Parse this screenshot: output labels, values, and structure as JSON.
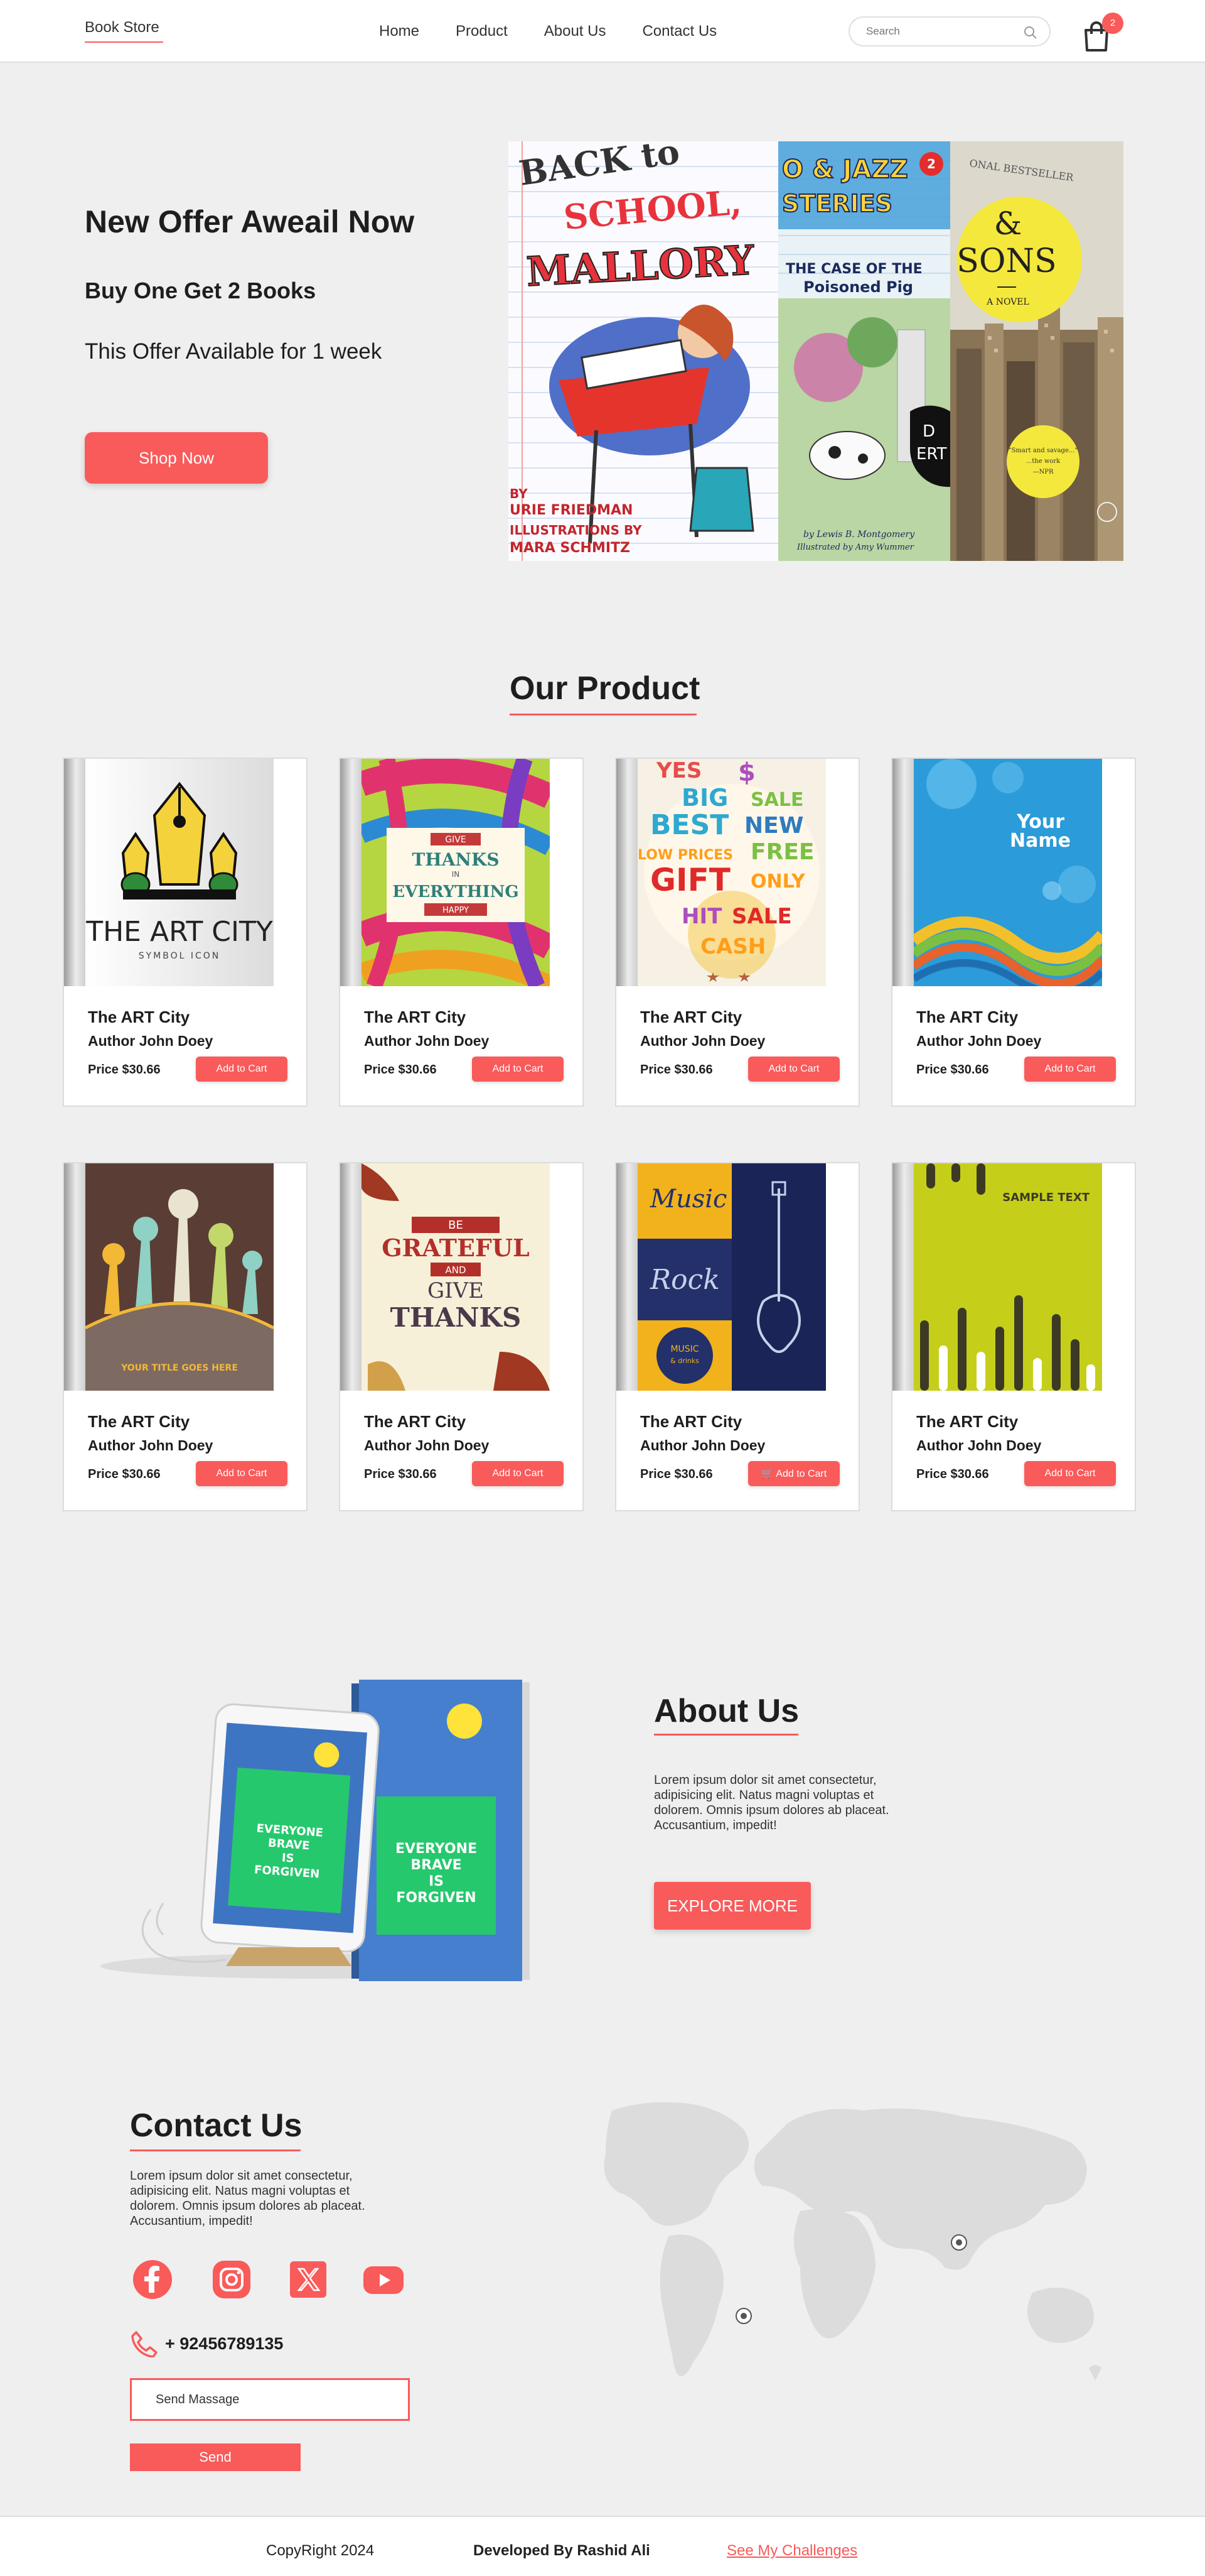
{
  "navbar": {
    "logo": "Book Store",
    "links": [
      "Home",
      "Product",
      "About Us",
      "Contact Us"
    ],
    "search_placeholder": "Search",
    "cart_count": "2"
  },
  "hero": {
    "title": "New Offer Aweail Now",
    "subtitle": "Buy One Get 2 Books",
    "offer": "This Offer Available for 1 week",
    "button": "Shop Now",
    "books": [
      {
        "title": "BACK TO SCHOOL, MALLORY",
        "author": "BY LAURIE FRIEDMAN",
        "illustrator": "ILLUSTRATIONS BY TAMARA SCHMITZ"
      },
      {
        "title": "ZEKE & JAZZ MYSTERIES",
        "badge": "2",
        "subtitle": "THE CASE OF THE POISONED PIG",
        "author": "by Lewis B. Montgomery",
        "illustrator": "Illustrated by Amy Wummer"
      },
      {
        "header": "NATIONAL BESTSELLER",
        "title": "& SONS",
        "subtitle": "A NOVEL"
      }
    ]
  },
  "products": {
    "title": "Our Product",
    "items": [
      {
        "name": "The ART City",
        "author": "Author John Doey",
        "price": "Price $30.66",
        "button": "Add to Cart",
        "cover_text": "THE ART CITY",
        "cover_sub": "SYMBOL ICON"
      },
      {
        "name": "The ART City",
        "author": "Author John Doey",
        "price": "Price $30.66",
        "button": "Add to Cart",
        "cover_text": "GIVE THANKS IN EVERYTHING HAPPY"
      },
      {
        "name": "The ART City",
        "author": "Author John Doey",
        "price": "Price $30.66",
        "button": "Add to Cart",
        "cover_text": "YES BIG BEST SALE NEW FREE GIFT ONLY"
      },
      {
        "name": "The ART City",
        "author": "Author John Doey",
        "price": "Price $30.66",
        "button": "Add to Cart",
        "cover_text": "Your Name"
      },
      {
        "name": "The ART City",
        "author": "Author John Doey",
        "price": "Price $30.66",
        "button": "Add to Cart",
        "cover_text": "YOUR TITLE GOES HERE"
      },
      {
        "name": "The ART City",
        "author": "Author John Doey",
        "price": "Price $30.66",
        "button": "Add to Cart",
        "cover_text": "BE GRATEFUL AND GIVE THANKS"
      },
      {
        "name": "The ART City",
        "author": "Author John Doey",
        "price": "Price $30.66",
        "button": "Add to Cart",
        "cover_text": "Music Rock"
      },
      {
        "name": "The ART City",
        "author": "Author John Doey",
        "price": "Price $30.66",
        "button": "Add to Cart",
        "cover_text": "SAMPLE TEXT"
      }
    ]
  },
  "about": {
    "title": "About Us",
    "text": "Lorem ipsum dolor sit amet consectetur, adipisicing elit. Natus magni voluptas et dolorem. Omnis ipsum dolores ab placeat. Accusantium, impedit!",
    "button": "EXPLORE MORE",
    "book_text": "EVERYONE BRAVE IS FORGIVEN"
  },
  "contact": {
    "title": "Contact Us",
    "text": "Lorem ipsum dolor sit amet consectetur, adipisicing elit. Natus magni voluptas et dolorem. Omnis ipsum dolores ab placeat. Accusantium, impedit!",
    "phone": "+ 92456789135",
    "message_placeholder": "Send Massage",
    "send_button": "Send",
    "socials": [
      "facebook-icon",
      "instagram-icon",
      "x-icon",
      "youtube-icon"
    ]
  },
  "footer": {
    "copyright": "CopyRight 2024",
    "developer": "Developed By Rashid Ali",
    "link": "See My Challenges"
  },
  "colors": {
    "accent": "#f95a5a",
    "background": "#efefef",
    "text": "#1e1e1e"
  }
}
